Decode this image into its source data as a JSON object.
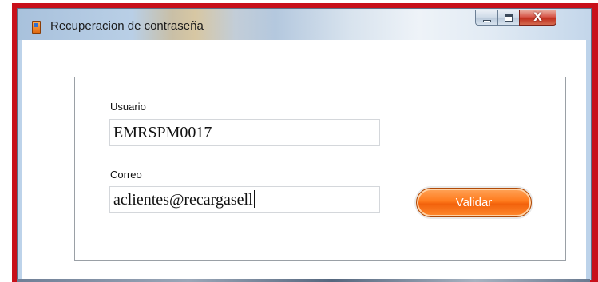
{
  "window": {
    "title": "Recuperacion de contraseña",
    "caption_buttons": {
      "minimize_icon": "minimize-icon",
      "maximize_icon": "maximize-icon",
      "close_icon": "close-icon",
      "close_glyph": "X"
    }
  },
  "form": {
    "usuario_label": "Usuario",
    "usuario_value": "EMRSPM0017",
    "correo_label": "Correo",
    "correo_value": "aclientes@recargasell",
    "validar_label": "Validar"
  },
  "colors": {
    "highlight_frame": "#c8101a",
    "button_accent": "#ff7a1c",
    "close_button": "#c0301f"
  }
}
